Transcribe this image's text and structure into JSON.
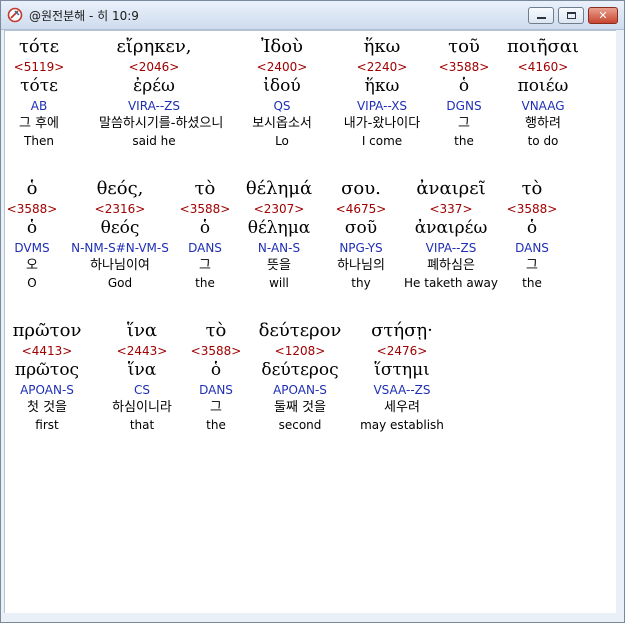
{
  "window": {
    "title": "@원전분해 - 히 10:9",
    "controls": {
      "minimize_icon": "minimize-icon",
      "maximize_icon": "maximize-icon",
      "close_label": "✕"
    }
  },
  "rows": [
    {
      "words": [
        {
          "greek": "τότε",
          "strong": "<5119>",
          "lemma": "τότε",
          "morph": "AB",
          "korean": "그 후에",
          "english": "Then"
        },
        {
          "greek": "εἴρηκεν,",
          "strong": "<2046>",
          "lemma": "ἐρέω",
          "morph": "VIRA--ZS",
          "korean": "말씀하시기를-하셨으니",
          "english": "said he"
        },
        {
          "greek": "Ἰδοὺ",
          "strong": "<2400>",
          "lemma": "ἰδού",
          "morph": "QS",
          "korean": "보시옵소서",
          "english": "Lo"
        },
        {
          "greek": "ἥκω",
          "strong": "<2240>",
          "lemma": "ἥκω",
          "morph": "VIPA--XS",
          "korean": "내가-왔나이다",
          "english": "I come"
        },
        {
          "greek": "τοῦ",
          "strong": "<3588>",
          "lemma": "ὁ",
          "morph": "DGNS",
          "korean": "그",
          "english": "the"
        },
        {
          "greek": "ποιῆσαι",
          "strong": "<4160>",
          "lemma": "ποιέω",
          "morph": "VNAAG",
          "korean": "행하려",
          "english": "to do"
        }
      ]
    },
    {
      "words": [
        {
          "greek": "ὁ",
          "strong": "<3588>",
          "lemma": "ὁ",
          "morph": "DVMS",
          "korean": "오",
          "english": "O"
        },
        {
          "greek": "θεός,",
          "strong": "<2316>",
          "lemma": "θεός",
          "morph": "N-NM-S#N-VM-S",
          "korean": "하나님이여",
          "english": "God"
        },
        {
          "greek": "τὸ",
          "strong": "<3588>",
          "lemma": "ὁ",
          "morph": "DANS",
          "korean": "그",
          "english": "the"
        },
        {
          "greek": "θέλημά",
          "strong": "<2307>",
          "lemma": "θέλημα",
          "morph": "N-AN-S",
          "korean": "뜻을",
          "english": "will"
        },
        {
          "greek": "σου.",
          "strong": "<4675>",
          "lemma": "σοῦ",
          "morph": "NPG-YS",
          "korean": "하나님의",
          "english": "thy"
        },
        {
          "greek": "ἀναιρεῖ",
          "strong": "<337>",
          "lemma": "ἀναιρέω",
          "morph": "VIPA--ZS",
          "korean": "폐하심은",
          "english": "He taketh away"
        },
        {
          "greek": "τὸ",
          "strong": "<3588>",
          "lemma": "ὁ",
          "morph": "DANS",
          "korean": "그",
          "english": "the"
        }
      ]
    },
    {
      "words": [
        {
          "greek": "πρῶτον",
          "strong": "<4413>",
          "lemma": "πρῶτος",
          "morph": "APOAN-S",
          "korean": "첫 것을",
          "english": "first"
        },
        {
          "greek": "ἵνα",
          "strong": "<2443>",
          "lemma": "ἵνα",
          "morph": "CS",
          "korean": "하심이니라",
          "english": "that"
        },
        {
          "greek": "τὸ",
          "strong": "<3588>",
          "lemma": "ὁ",
          "morph": "DANS",
          "korean": "그",
          "english": "the"
        },
        {
          "greek": "δεύτερον",
          "strong": "<1208>",
          "lemma": "δεύτερος",
          "morph": "APOAN-S",
          "korean": "둘째 것을",
          "english": "second"
        },
        {
          "greek": "στήσῃ·",
          "strong": "<2476>",
          "lemma": "ἵστημι",
          "morph": "VSAA--ZS",
          "korean": "세우려",
          "english": "may establish"
        }
      ]
    }
  ]
}
